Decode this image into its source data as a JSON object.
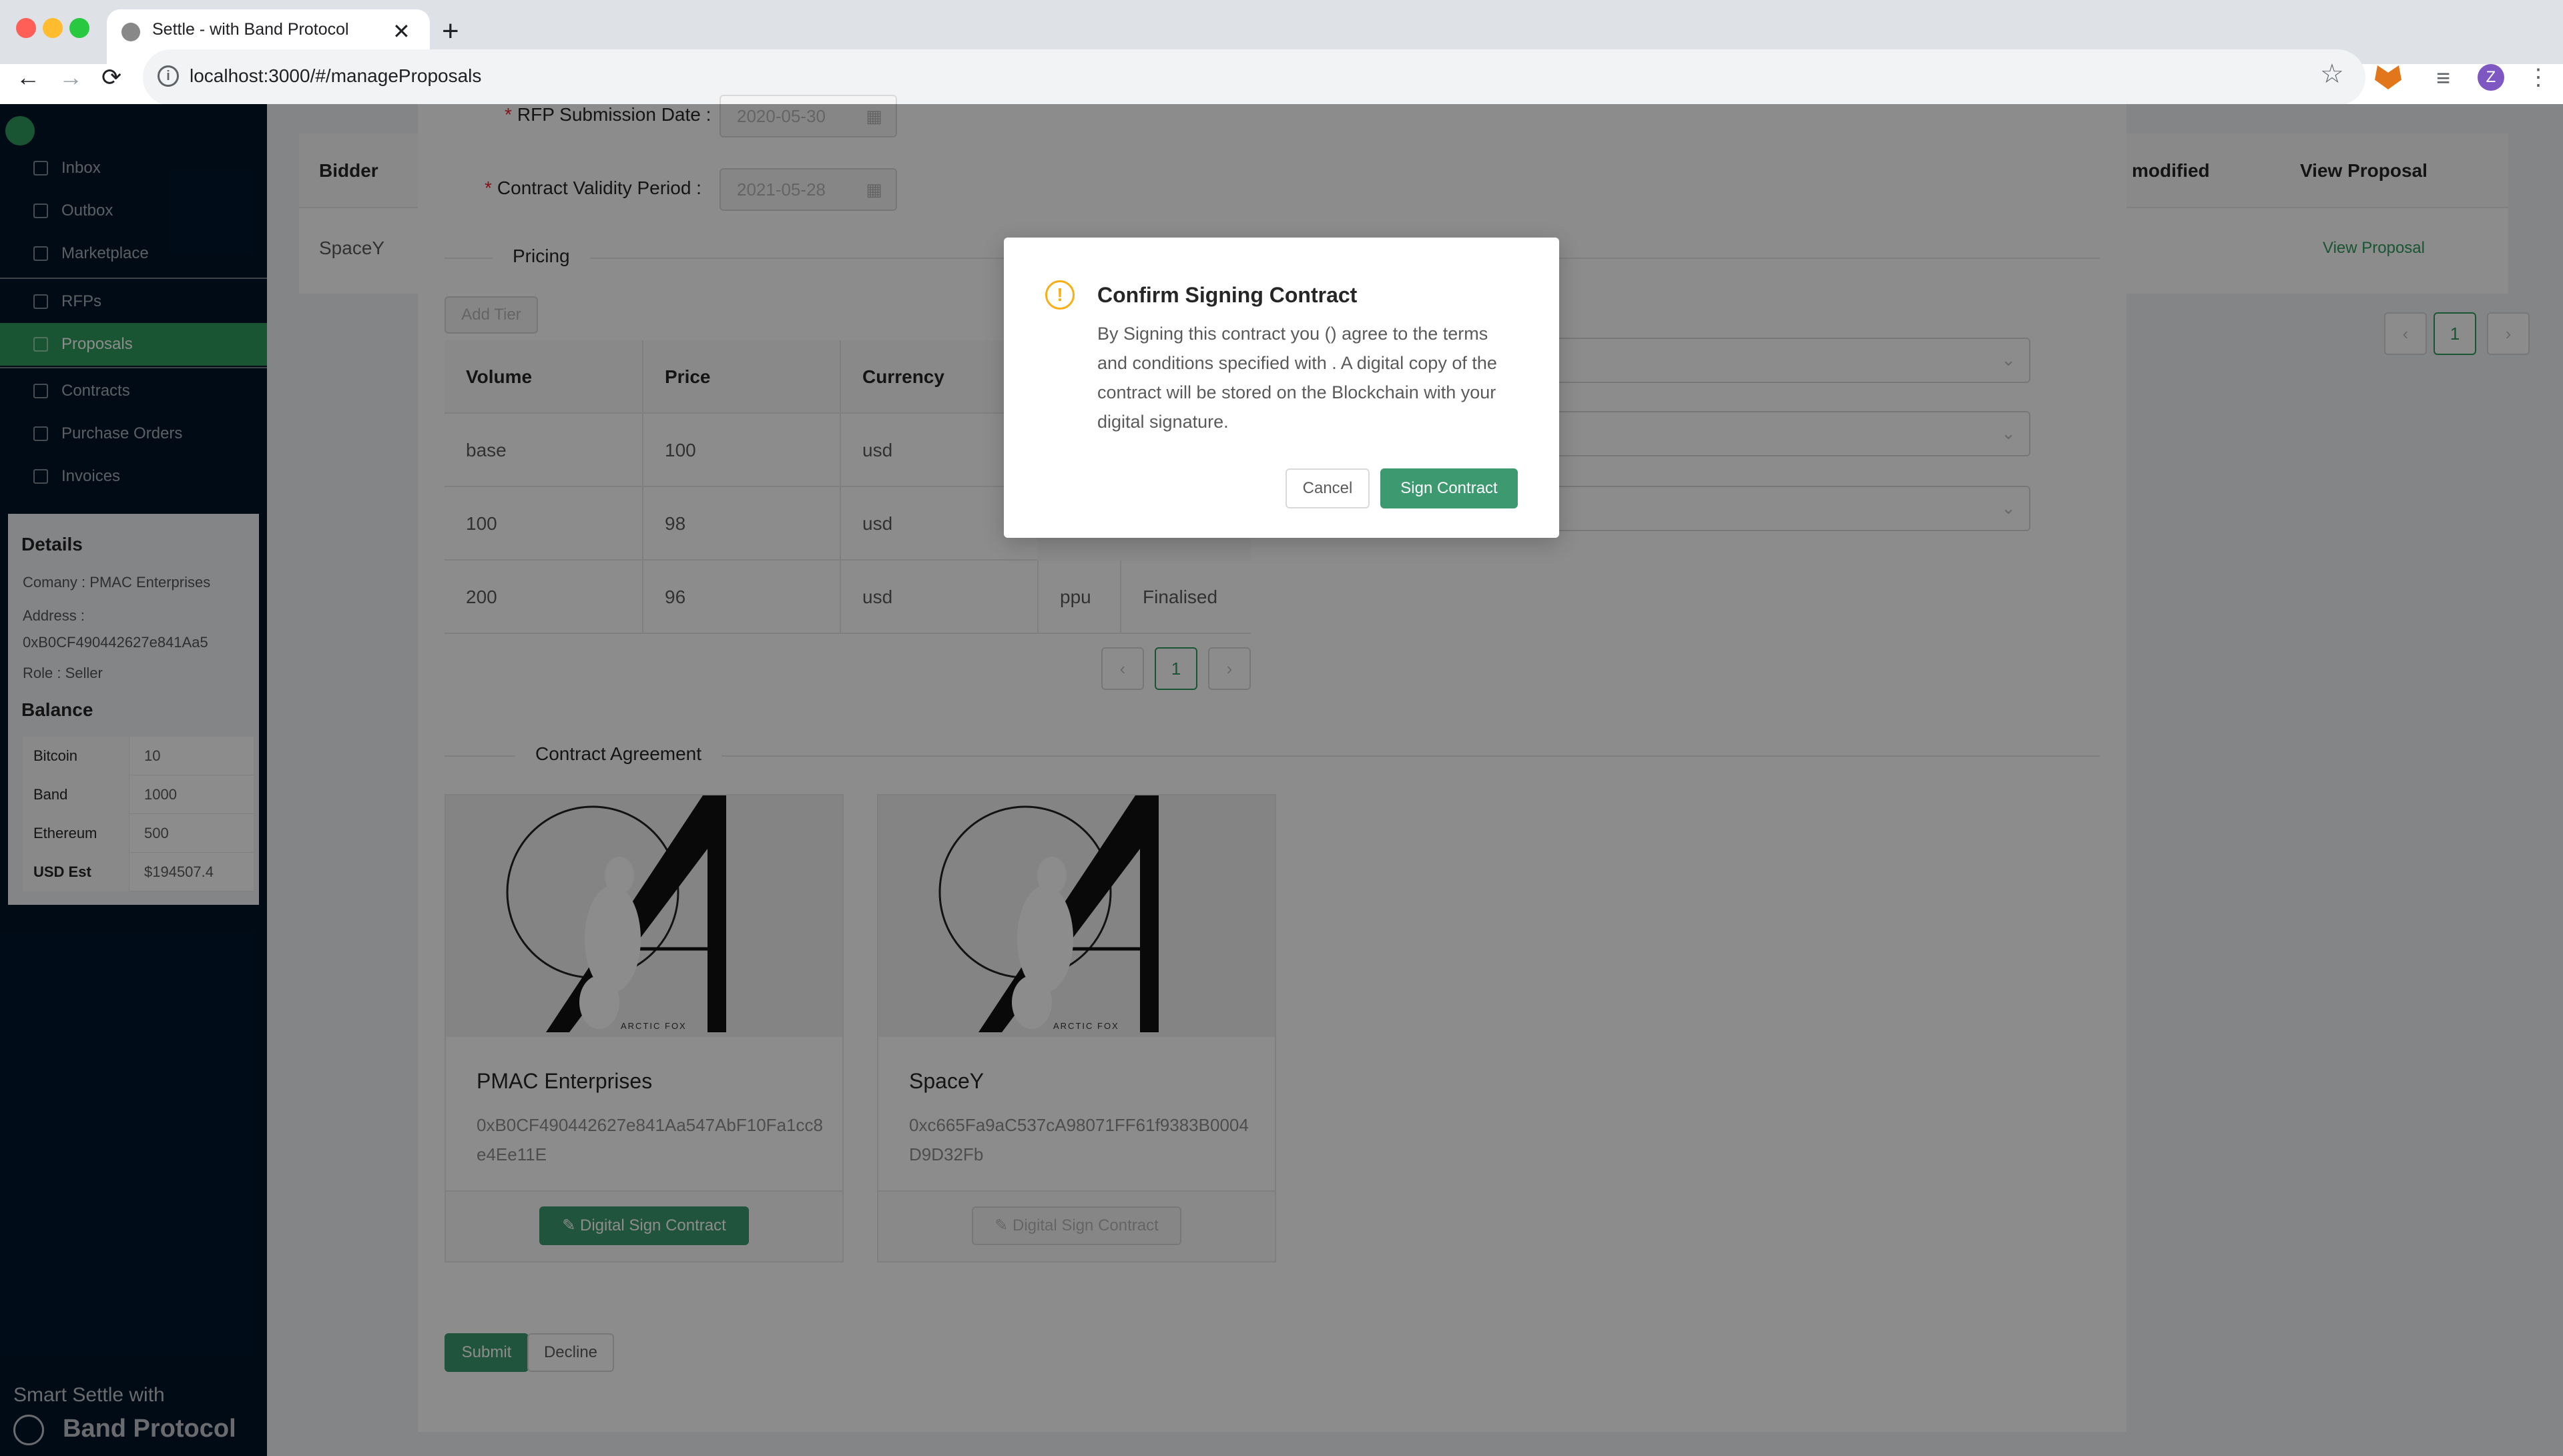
{
  "browser": {
    "tab_title": "Settle - with Band Protocol",
    "url": "localhost:3000/#/manageProposals",
    "profile_initial": "Z"
  },
  "sidebar": {
    "items": [
      {
        "label": "Inbox",
        "icon": "mail-icon"
      },
      {
        "label": "Outbox",
        "icon": "send-icon"
      },
      {
        "label": "Marketplace",
        "icon": "shop-icon"
      },
      {
        "label": "RFPs",
        "icon": "tag-icon"
      },
      {
        "label": "Proposals",
        "icon": "file-icon",
        "active": true
      },
      {
        "label": "Contracts",
        "icon": "file-icon"
      },
      {
        "label": "Purchase Orders",
        "icon": "table-icon"
      },
      {
        "label": "Invoices",
        "icon": "table-icon"
      }
    ],
    "details": {
      "heading": "Details",
      "company_label": "Comany :",
      "company": "PMAC Enterprises",
      "address_label": "Address :",
      "address": "0xB0CF490442627e841Aa5",
      "role_label": "Role :",
      "role": "Seller"
    },
    "balance": {
      "heading": "Balance",
      "rows": [
        {
          "key": "Bitcoin",
          "value": "10"
        },
        {
          "key": "Band",
          "value": "1000"
        },
        {
          "key": "Ethereum",
          "value": "500"
        },
        {
          "key": "USD Est",
          "value": "$194507.4"
        }
      ]
    },
    "footer": {
      "line1": "Smart Settle with",
      "line2": "Band Protocol"
    }
  },
  "main_table": {
    "headers": {
      "bidder": "Bidder",
      "modified": "modified",
      "view": "View Proposal"
    },
    "row": {
      "bidder": "SpaceY",
      "view_link": "View Proposal"
    },
    "page": "1"
  },
  "proposal": {
    "rfp_submission_label": "RFP Submission Date",
    "rfp_submission_date": "2020-05-30",
    "validity_label": "Contract Validity Period",
    "validity_date": "2021-05-28",
    "pricing_title": "Pricing",
    "add_tier": "Add Tier",
    "columns": [
      "Volume",
      "Price",
      "Currency"
    ],
    "rows": [
      {
        "volume": "base",
        "price": "100",
        "currency": "usd"
      },
      {
        "volume": "100",
        "price": "98",
        "currency": "usd"
      },
      {
        "volume": "200",
        "price": "96",
        "currency": "usd",
        "unit": "ppu",
        "status": "Finalised"
      }
    ],
    "page": "1",
    "agreement_title": "Contract Agreement",
    "parties": [
      {
        "name": "PMAC Enterprises",
        "address": "0xB0CF490442627e841Aa547AbF10Fa1cc8e4Ee11E",
        "sign_label": "Digital Sign Contract",
        "enabled": true
      },
      {
        "name": "SpaceY",
        "address": "0xc665Fa9aC537cA98071FF61f9383B0004D9D32Fb",
        "sign_label": "Digital Sign Contract",
        "enabled": false
      }
    ],
    "image_caption": "ARCTIC FOX",
    "submit": "Submit",
    "decline": "Decline"
  },
  "modal": {
    "title": "Confirm Signing Contract",
    "body": "By Signing this contract you () agree to the terms and conditions specified with . A digital copy of the contract will be stored on the Blockchain with your digital signature.",
    "cancel": "Cancel",
    "confirm": "Sign Contract"
  },
  "colors": {
    "accent": "#3d9970",
    "sidebar": "#001529",
    "warning": "#faad14"
  }
}
